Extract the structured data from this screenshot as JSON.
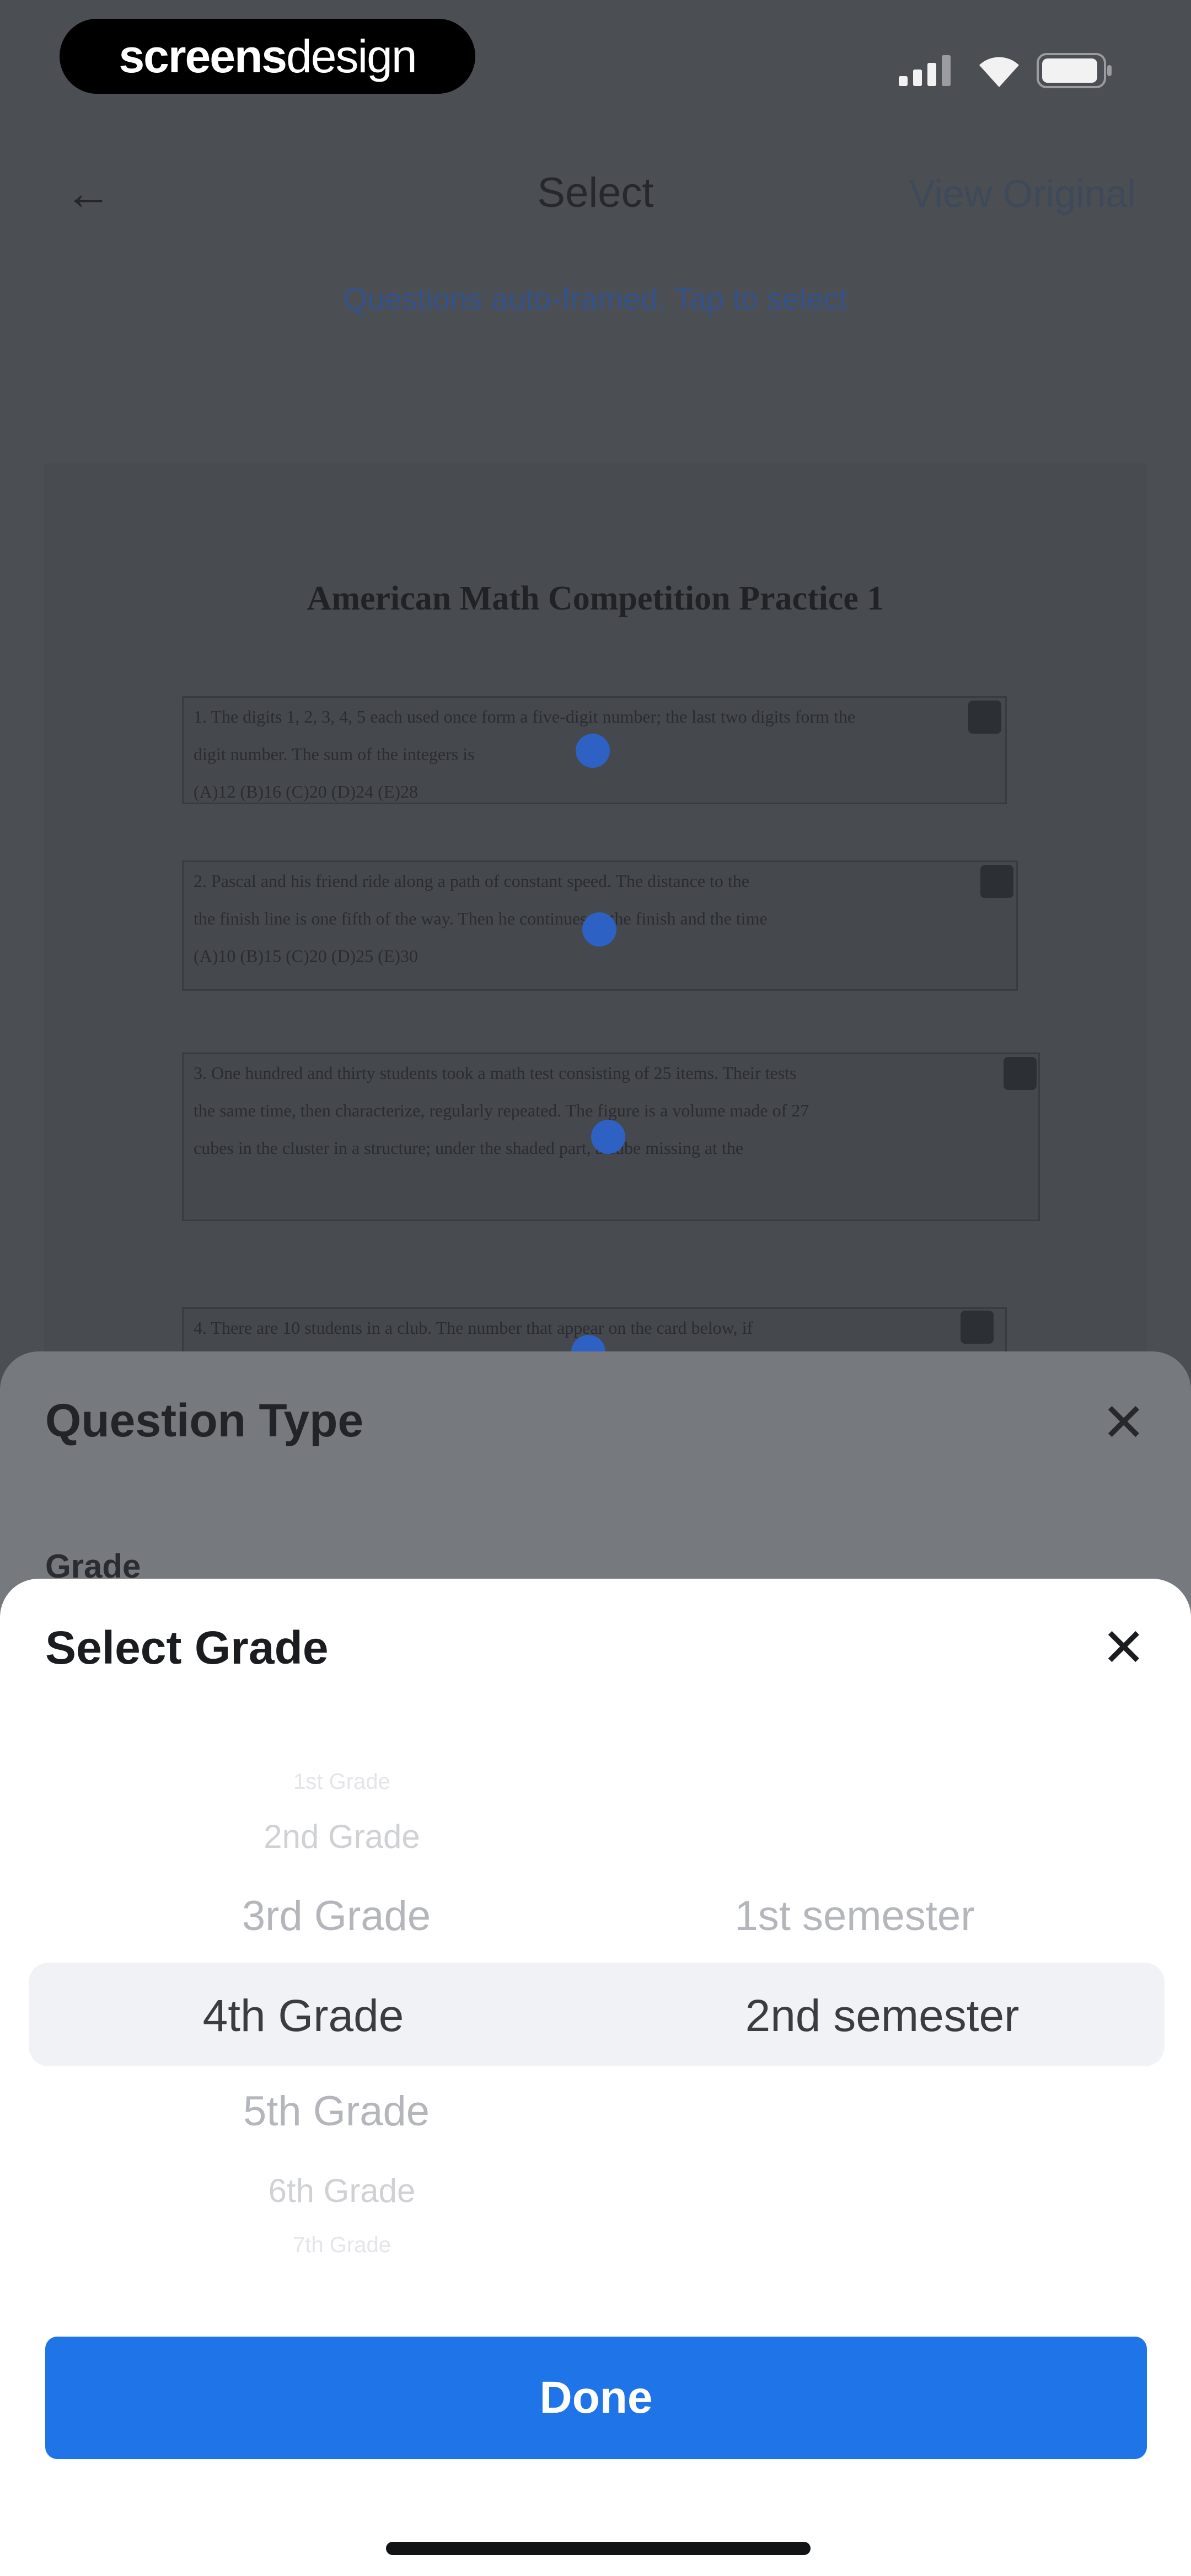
{
  "status": {
    "logo_bold": "screens",
    "logo_light": "design"
  },
  "nav": {
    "back": "←",
    "title": "Select",
    "right": "View Original"
  },
  "hint": "Questions auto-framed. Tap to select",
  "paper": {
    "title": "American Math Competition Practice 1",
    "questions": [
      {
        "line1": "1. The digits 1, 2, 3, 4, 5 each used once form a five-digit number; the last two digits form the",
        "line2": "digit number. The sum of the integers is",
        "line3": "(A)12        (B)16        (C)20        (D)24        (E)28"
      },
      {
        "line1": "2. Pascal and his friend ride along a path of constant speed. The distance to the",
        "line2": "the finish line is one fifth of the way. Then he continues to the finish and the time",
        "line3": "(A)10        (B)15        (C)20        (D)25        (E)30"
      },
      {
        "line1": "3. One hundred and thirty students took a math test consisting of 25 items. Their tests",
        "line2": "the same time, then characterize, regularly repeated. The figure is a volume made of 27",
        "line3": "cubes in the cluster in a structure; under the shaded part, a cube missing at the"
      },
      {
        "line1": "4. There are 10 students in a club. The number that appear on the card below, if",
        "line2": "",
        "line3": ""
      }
    ]
  },
  "sheet1": {
    "title": "Question Type",
    "close": "✕",
    "grade_label": "Grade"
  },
  "sheet2": {
    "title": "Select Grade",
    "close": "✕"
  },
  "picker": {
    "grades": [
      "1st Grade",
      "2nd Grade",
      "3rd Grade",
      "4th Grade",
      "5th Grade",
      "6th Grade",
      "7th Grade"
    ],
    "selected_grade": "4th Grade",
    "semesters": [
      "1st semester",
      "2nd semester"
    ],
    "selected_semester": "2nd semester"
  },
  "done_label": "Done",
  "colors": {
    "accent": "#1f75e8",
    "overlay": "#4b4e53",
    "sheet": "#ffffff"
  }
}
